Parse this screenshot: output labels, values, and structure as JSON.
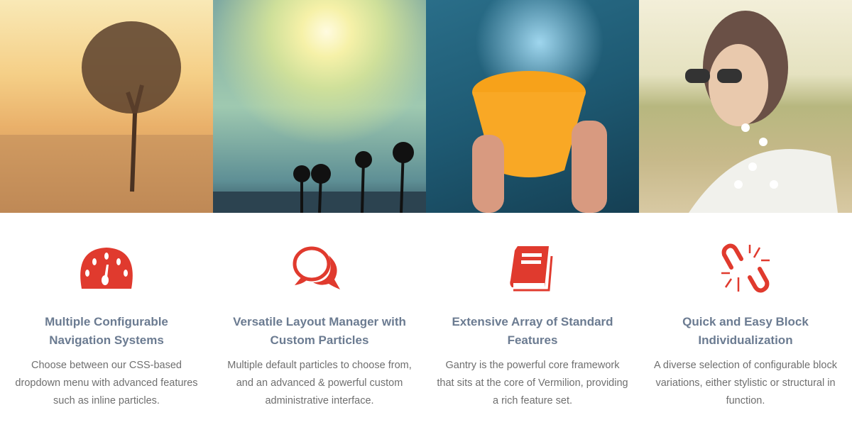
{
  "accent_color": "#e03a2e",
  "photos": [
    {
      "name": "tree-in-field-photo"
    },
    {
      "name": "sun-palms-photo"
    },
    {
      "name": "water-bucket-photo"
    },
    {
      "name": "woman-flowers-photo"
    }
  ],
  "features": [
    {
      "icon": "dashboard-icon",
      "title": "Multiple Configurable Navigation Systems",
      "description": "Choose between our CSS-based dropdown menu with advanced features such as inline particles."
    },
    {
      "icon": "comments-icon",
      "title": "Versatile Layout Manager with Custom Particles",
      "description": "Multiple default particles to choose from, and an advanced & powerful custom administrative interface."
    },
    {
      "icon": "book-icon",
      "title": "Extensive Array of Standard Features",
      "description": "Gantry is the powerful core framework that sits at the core of Vermilion, providing a rich feature set."
    },
    {
      "icon": "chain-broken-icon",
      "title": "Quick and Easy Block Individualization",
      "description": "A diverse selection of configurable block variations, either stylistic or structural in function."
    }
  ]
}
